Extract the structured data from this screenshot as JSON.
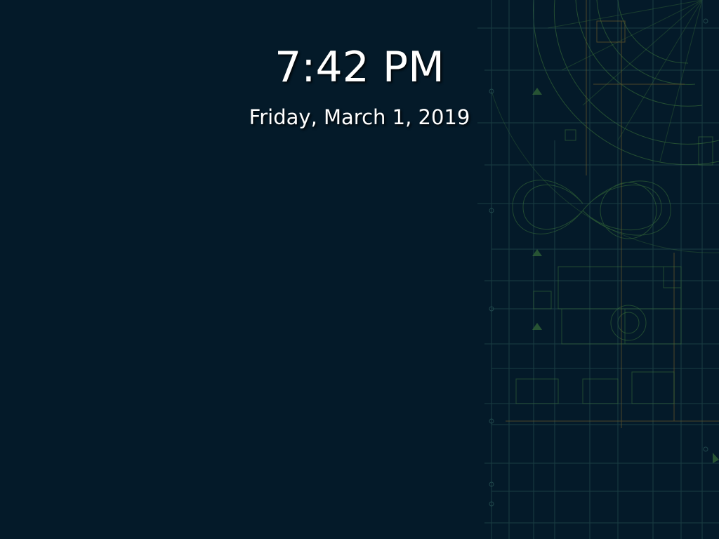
{
  "lock_screen": {
    "time": "7:42 PM",
    "date": "Friday, March 1, 2019"
  },
  "wallpaper": {
    "background_color": "#041a29",
    "line_color_green": "#3f7a3a",
    "line_color_teal": "#2c5a5a",
    "line_color_amber": "#6b5a2a"
  }
}
